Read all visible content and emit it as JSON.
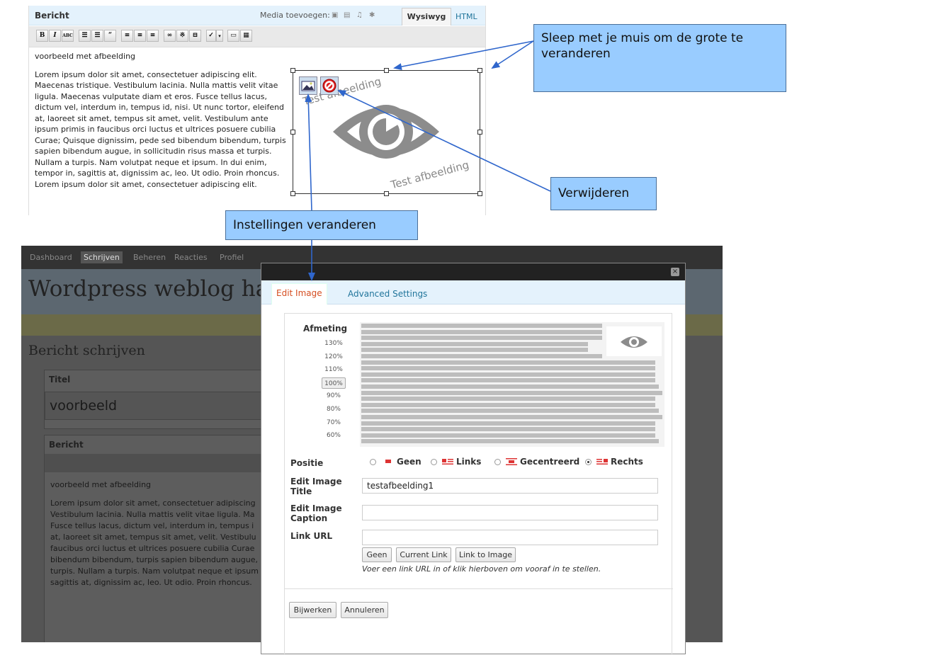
{
  "top_editor": {
    "title": "Bericht",
    "media_label": "Media toevoegen:",
    "tab_wysiwyg": "Wysiwyg",
    "tab_html": "HTML",
    "toolbar_icons": [
      "bold-icon",
      "italic-icon",
      "strikethrough-icon",
      "bullet-list-icon",
      "numbered-list-icon",
      "blockquote-icon",
      "align-left-icon",
      "align-center-icon",
      "align-right-icon",
      "link-icon",
      "unlink-icon",
      "more-icon",
      "spellcheck-icon",
      "dropdown-icon",
      "fullscreen-icon",
      "kitchen-sink-icon"
    ],
    "heading": "voorbeeld met afbeelding",
    "paragraph_lines": [
      "Lorem ipsum dolor sit amet, consectetuer adipiscing elit.",
      "Maecenas tristique. Vestibulum lacinia. Nulla mattis velit vitae",
      "ligula. Maecenas vulputate diam et eros. Fusce tellus lacus,",
      "dictum vel, interdum in, tempus id, nisi. Ut nunc tortor, eleifend",
      "at, laoreet sit amet, tempus sit amet, velit. Vestibulum ante",
      "ipsum primis in faucibus orci luctus et ultrices posuere cubilia",
      "Curae; Quisque dignissim, pede sed bibendum bibendum, turpis",
      "sapien bibendum augue, in sollicitudin risus massa et turpis.",
      "Nullam a turpis. Nam volutpat neque et ipsum. In dui enim,",
      "tempor in, sagittis at, dignissim ac, leo. Ut odio. Proin rhoncus.",
      "Lorem ipsum dolor sit amet, consectetuer adipiscing elit."
    ],
    "image_text_top": "Test afbeelding",
    "image_text_bottom": "Test afbeelding"
  },
  "callouts": {
    "resize": "Sleep met je muis om de grote te veranderen",
    "delete": "Verwijderen",
    "settings": "Instellingen veranderen"
  },
  "wp": {
    "nav": [
      "Dashboard",
      "Schrijven",
      "Beheren",
      "Reacties",
      "Profiel"
    ],
    "blog_title": "Wordpress weblog han",
    "page_heading": "Bericht schrijven",
    "title_label": "Titel",
    "title_value": "voorbeeld",
    "editor_label": "Bericht",
    "body_heading": "voorbeeld met afbeelding",
    "body_lines": [
      "Lorem ipsum dolor sit amet, consectetuer adipiscing",
      "Vestibulum lacinia. Nulla mattis velit vitae ligula. Ma",
      "Fusce tellus lacus, dictum vel, interdum in, tempus i",
      "at, laoreet sit amet, tempus sit amet, velit. Vestibulu",
      "faucibus orci luctus et ultrices posuere cubilia Curae",
      "bibendum bibendum, turpis sapien bibendum augue,",
      "turpis. Nullam a turpis. Nam volutpat neque et ipsum",
      "sagittis at, dignissim ac, leo. Ut odio. Proin rhoncus."
    ]
  },
  "modal": {
    "close": "×",
    "tabs": [
      "Edit Image",
      "Advanced Settings"
    ],
    "size_label": "Afmeting",
    "sizes": [
      "130%",
      "120%",
      "110%",
      "100%",
      "90%",
      "80%",
      "70%",
      "60%"
    ],
    "selected_size": "100%",
    "position_label": "Positie",
    "positions": [
      "Geen",
      "Links",
      "Gecentreerd",
      "Rechts"
    ],
    "selected_position": "Rechts",
    "title_label": "Edit Image Title",
    "title_value": "testafbeelding1",
    "caption_label": "Edit Image Caption",
    "caption_value": "",
    "link_label": "Link URL",
    "link_value": "",
    "link_buttons": [
      "Geen",
      "Current Link",
      "Link to Image"
    ],
    "link_hint": "Voer een link URL in of klik hierboven om vooraf in te stellen.",
    "update_button": "Bijwerken",
    "cancel_button": "Annuleren"
  },
  "colors": {
    "callout_bg": "#99ccff",
    "link_blue": "#21759b",
    "arrow_blue": "#3366cc",
    "active_tab": "#d54e21"
  }
}
